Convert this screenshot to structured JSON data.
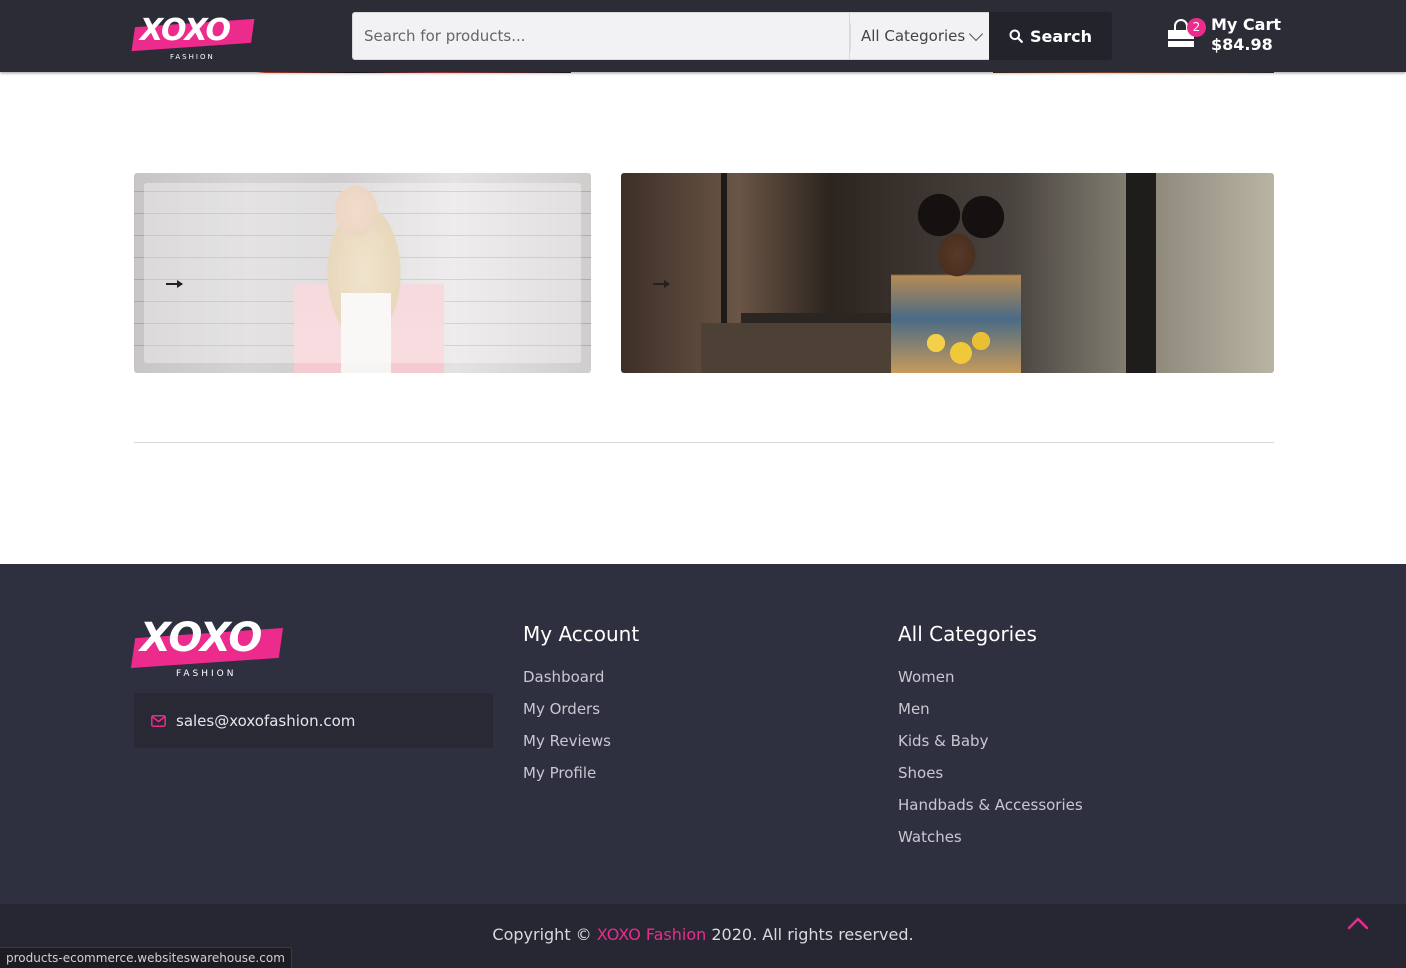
{
  "header": {
    "logo_text": "XOXO",
    "logo_sub": "FASHION",
    "search": {
      "placeholder": "Search for products...",
      "category": "All Categories",
      "button_label": "Search"
    },
    "cart": {
      "badge_count": "2",
      "title": "My Cart",
      "total": "$84.98"
    }
  },
  "colors": {
    "brand_pink": "#ec2b8c",
    "header_bg": "#2c2c36",
    "footer_bg": "#2f303f"
  },
  "footer": {
    "logo_text": "XOXO",
    "logo_sub": "FASHION",
    "email": "sales@xoxofashion.com",
    "account": {
      "title": "My Account",
      "links": [
        "Dashboard",
        "My Orders",
        "My Reviews",
        "My Profile"
      ]
    },
    "categories": {
      "title": "All Categories",
      "links": [
        "Women",
        "Men",
        "Kids & Baby",
        "Shoes",
        "Handbads & Accessories",
        "Watches"
      ]
    },
    "copyright": {
      "prefix": "Copyright ©",
      "brand": "XOXO Fashion",
      "suffix": "2020. All rights reserved."
    }
  },
  "statusbar": {
    "url": "products-ecommerce.websiteswarehouse.com"
  }
}
